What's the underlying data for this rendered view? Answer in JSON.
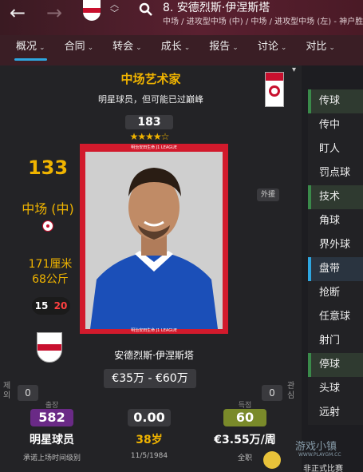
{
  "header": {
    "player_title": "8. 安德烈斯·伊涅斯塔",
    "player_subtitle": "中场 / 进攻型中场 (中) / 中场 / 进攻型中场 (左) - 神户胜利船",
    "back_icon": "arrow-left-icon",
    "forward_icon": "arrow-right-icon",
    "search_icon": "search-icon"
  },
  "tabs": [
    {
      "label": "概况",
      "active": true
    },
    {
      "label": "合同"
    },
    {
      "label": "转会"
    },
    {
      "label": "成长"
    },
    {
      "label": "报告"
    },
    {
      "label": "讨论"
    },
    {
      "label": "对比"
    }
  ],
  "profile": {
    "role": "中场艺术家",
    "role_desc": "明星球员，但可能已过巅峰",
    "potential_ability": "183",
    "stars": "★★★★☆",
    "current_ability": "133",
    "position": "中场 (中)",
    "height": "171厘米",
    "weight": "68公斤",
    "left_foot": "15",
    "right_foot": "20",
    "foreign_tag": "外援",
    "photo_caption_top": "明治安田生命 J1 LEAGUE",
    "photo_caption_bottom": "明治安田生命 J1 LEAGUE",
    "name": "安德烈斯·伊涅斯塔",
    "value": "€35万 - €60万"
  },
  "side_boxes": {
    "left_label": "제외",
    "left_value": "0",
    "right_label": "관심",
    "right_value": "0"
  },
  "stats": [
    {
      "caption": "출장",
      "pill": "582",
      "main": "明星球员",
      "sub": "承诺上场时间级别"
    },
    {
      "caption": "",
      "pill": "0.00",
      "main": "38岁",
      "sub": "11/5/1984"
    },
    {
      "caption": "득점",
      "pill": "60",
      "main": "€3.55万/周",
      "sub": "全职"
    }
  ],
  "sidebar": [
    {
      "label": "传球",
      "style": "green"
    },
    {
      "label": "传中",
      "style": "plain"
    },
    {
      "label": "盯人",
      "style": "plain"
    },
    {
      "label": "罚点球",
      "style": "plain"
    },
    {
      "label": "技术",
      "style": "green"
    },
    {
      "label": "角球",
      "style": "plain"
    },
    {
      "label": "界外球",
      "style": "plain"
    },
    {
      "label": "盘带",
      "style": "blue"
    },
    {
      "label": "抢断",
      "style": "plain"
    },
    {
      "label": "任意球",
      "style": "plain"
    },
    {
      "label": "射门",
      "style": "plain"
    },
    {
      "label": "停球",
      "style": "green"
    },
    {
      "label": "头球",
      "style": "plain"
    },
    {
      "label": "远射",
      "style": "plain"
    }
  ],
  "watermark": "游戏小镇",
  "watermark_sub": "WWW.PLAYGM.CC",
  "footer_note": "非正式比赛",
  "colors": {
    "accent": "#f0b400",
    "header": "#5a2030",
    "tab_underline": "#2ea6e0",
    "pill_green": "#7a8a2a",
    "pill_purple": "#6a2a86"
  }
}
